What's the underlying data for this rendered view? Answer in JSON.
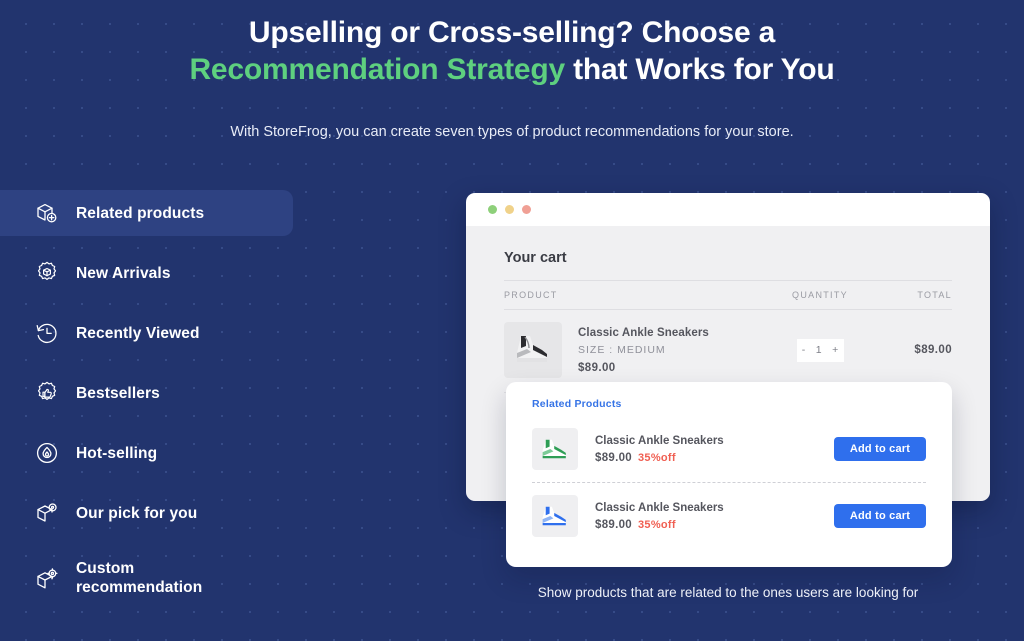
{
  "header": {
    "headline_part1": "Upselling or Cross-selling? Choose a ",
    "headline_highlight1": "Recommendation Strategy",
    "headline_part2": " that Works for You",
    "subline": "With StoreFrog, you can create seven types of product recommendations for your store."
  },
  "sidebar": {
    "items": [
      {
        "label": "Related products",
        "icon": "box-plus-icon",
        "active": true
      },
      {
        "label": "New Arrivals",
        "icon": "badge-cube-icon",
        "active": false
      },
      {
        "label": "Recently Viewed",
        "icon": "clock-rewind-icon",
        "active": false
      },
      {
        "label": "Bestsellers",
        "icon": "badge-thumbs-up-icon",
        "active": false
      },
      {
        "label": "Hot-selling",
        "icon": "flame-circle-icon",
        "active": false
      },
      {
        "label": "Our pick for you",
        "icon": "box-target-icon",
        "active": false
      },
      {
        "label": "Custom recommendation",
        "icon": "box-gear-icon",
        "active": false
      }
    ]
  },
  "mock": {
    "window_dots": [
      "green",
      "yellow",
      "red"
    ],
    "cart": {
      "title": "Your cart",
      "columns": {
        "product": "PRODUCT",
        "quantity": "QUANTITY",
        "total": "TOTAL"
      },
      "rows": [
        {
          "name": "Classic Ankle Sneakers",
          "size": "SIZE : MEDIUM",
          "price": "$89.00",
          "qty_minus": "-",
          "qty_value": "1",
          "qty_plus": "+",
          "total": "$89.00",
          "thumb": "sneaker-black-white"
        }
      ]
    },
    "related": {
      "title": "Related Products",
      "items": [
        {
          "name": "Classic Ankle Sneakers",
          "price": "$89.00",
          "discount": "35%off",
          "button": "Add to cart",
          "thumb": "sneaker-green"
        },
        {
          "name": "Classic Ankle Sneakers",
          "price": "$89.00",
          "discount": "35%off",
          "button": "Add to cart",
          "thumb": "sneaker-blue"
        }
      ]
    }
  },
  "caption": "Show products that are related to the ones users are looking for",
  "colors": {
    "background": "#22346e",
    "accent_green": "#5ed07f",
    "accent_blue": "#2f6fed",
    "discount_red": "#f05f52",
    "panel_grey": "#f0f0f2",
    "active_item": "#2e4282"
  }
}
